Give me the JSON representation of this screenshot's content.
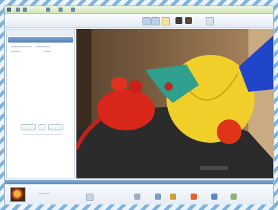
{
  "window": {
    "title_icons": [
      "app-icon",
      "file-icon",
      "edit-icon",
      "view-icon",
      "tools-icon",
      "help-icon"
    ]
  },
  "toolbar": {
    "tool_icons": [
      "rotate-left-icon",
      "rotate-right-icon",
      "crop-icon",
      "redeye-icon",
      "enhance-icon",
      "prev-icon"
    ]
  },
  "left_panel": {
    "selected_row_color": "#5a87bd"
  },
  "photo": {
    "subject": "felt toys",
    "colors": {
      "red_mouse": "#d8261a",
      "yellow_ball": "#f1cf2a",
      "teal_bird": "#2f9f8e",
      "blue_toy": "#2145c8",
      "dark_block": "#2b2b2b"
    }
  },
  "filmstrip": {
    "icons": [
      "fix-icon",
      "print-icon",
      "email-icon",
      "share-icon",
      "order-icon",
      "burn-icon",
      "open-icon"
    ],
    "accent": "#e0622a"
  }
}
